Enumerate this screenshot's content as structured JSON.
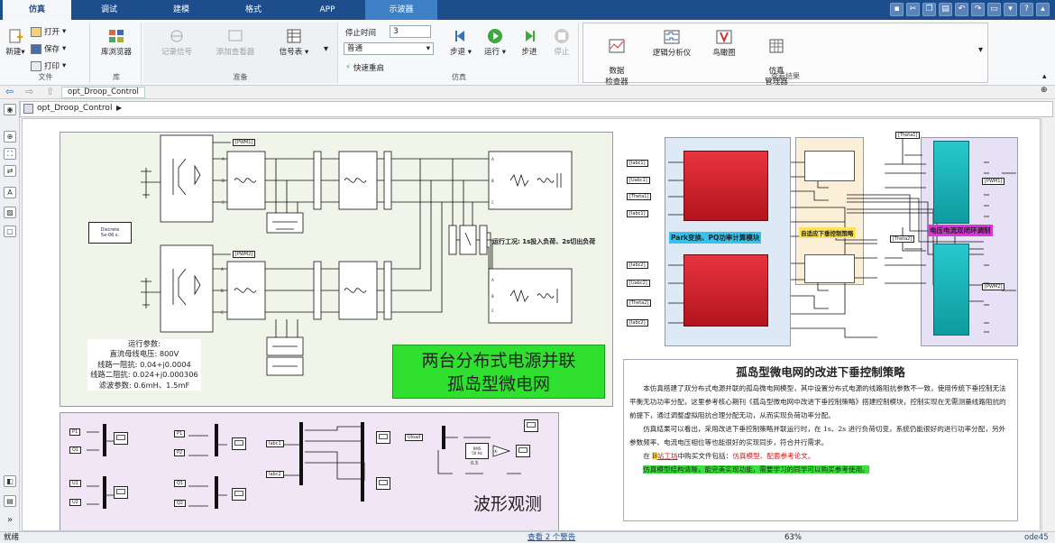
{
  "tabs": [
    "仿真",
    "调试",
    "建模",
    "格式",
    "APP",
    "示波器"
  ],
  "ribbon": {
    "file": {
      "new": "新建",
      "open": "打开",
      "save": "保存",
      "print": "打印",
      "label": "文件"
    },
    "library": {
      "browser": "库浏览器",
      "label": "库"
    },
    "prepare": {
      "log": "记录信号",
      "add_viewer": "添加查看器",
      "signal_table": "信号表",
      "label": "准备"
    },
    "simulate": {
      "stop_time_label": "停止时间",
      "stop_time": "3",
      "mode": "普通",
      "fast_restart": "快速重启",
      "step_back": "步退",
      "run": "运行",
      "step_fwd": "步进",
      "stop": "停止",
      "label": "仿真"
    },
    "review": {
      "data_inspector": "数据\n检查器",
      "logic_analyzer": "逻辑分析仪",
      "bird_eye": "鸟瞰图",
      "sim_manager": "仿真\n管理器",
      "label": "查看结果"
    }
  },
  "nav": {
    "tab": "opt_Droop_Control"
  },
  "address": {
    "path": "opt_Droop_Control"
  },
  "model": {
    "discrete": "Discrete\n5e-06 s.",
    "params_title": "运行参数:",
    "params": [
      "直流母线电压: 800V",
      "线路一阻抗: 0.04+j0.0004",
      "线路二阻抗: 0.024+j0.000306",
      "滤波参数: 0.6mH、1.5mF"
    ],
    "condition": "运行工况: 1s投入负荷、2s切出负荷",
    "main_title": [
      "两台分布式电源并联",
      "孤岛型微电网"
    ],
    "wave_label": "波形观测",
    "park_label": "Park变换、PQ功率计算模块",
    "droop_label": "自适应下垂控制策略",
    "loop_label": "电压电流双闭环调制",
    "tags_left": [
      "[PWM1]",
      "[PWM2]"
    ],
    "tags_ctrl_in1": [
      "[Iabc1]",
      "[Uabc1]",
      "[Theta1]",
      "[Iabc1]"
    ],
    "tags_ctrl_in2": [
      "[Iabc2]",
      "[Uabc2]",
      "[Theta2]",
      "[Iabc2]"
    ],
    "tags_ctrl_out": [
      "[PWM1]",
      "[PWM2]"
    ],
    "tags_theta": [
      "[Theta1]",
      "[Theta2]"
    ],
    "scope_in": [
      "P1",
      "Q1",
      "U1",
      "U2",
      "P1",
      "P2",
      "Q1",
      "Q2",
      "Iabc1",
      "Iabc2",
      "Uload"
    ],
    "rms": "RMS\n50 Hz",
    "gain": "-K-",
    "rms_n": "0.3"
  },
  "description": {
    "title": "孤岛型微电网的改进下垂控制策略",
    "p1": "本仿真搭建了双分布式电源并联的孤岛微电网模型，其中设置分布式电源的线路阻抗参数不一致，使用传统下垂控制无法平衡无功功率分配，这里参考核心期刊《孤岛型微电网中改进下垂控制策略》搭建控制模块，控制实现在无需测量线路阻抗的前提下，通过调整虚拟阻抗合理分配无功，从而实现负荷功率分配。",
    "p2": "仿真结果可以看出，采用改进下垂控制策略并联运行时，在 1s、2s 进行负荷切变，系统仍能很好的进行功率分配，另外参数频率、电流电压相位等也能很好的实现同步，符合并行需求。",
    "p3_pre": "在",
    "p3_b": "B",
    "p3_site": "站工坊",
    "p3_mid": "中购买文件包括：",
    "p3_red": "仿真模型、配套参考论文。",
    "p4": "仿真模型结构清晰，能完美实现功能，需要学习的同学可以购买参考使用。"
  },
  "status": {
    "left": "就绪",
    "warn": "查看 2 个警告",
    "zoom": "63%",
    "solver": "ode45"
  },
  "colors": {
    "tabbar": "#1e4d8c",
    "power_bg": "#f1f5e9",
    "wave_bg": "#f1e6f5",
    "park_bg": "#ddeaf6",
    "droop_bg": "#fcefd8",
    "loop_bg": "#e7e1f5",
    "title_green": "#2fe02f",
    "park_label_bg": "#35c3ec",
    "loop_label_bg": "#e033e0",
    "droop_label_bg": "#fbe25b"
  }
}
